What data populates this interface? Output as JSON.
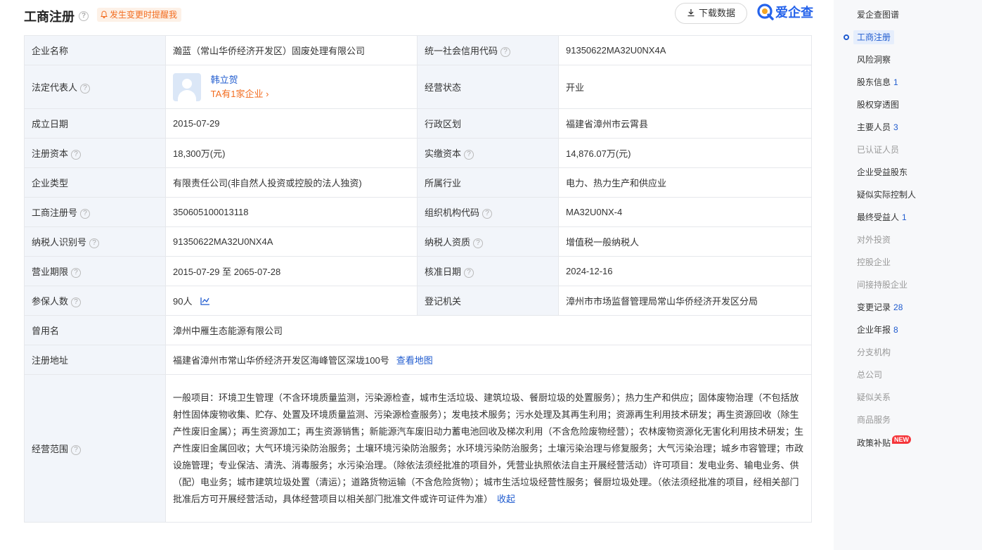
{
  "header": {
    "title": "工商注册",
    "notify_label": "发生变更时提醒我",
    "download_label": "下载数据",
    "brand_name": "爱企查"
  },
  "rows": [
    {
      "l1": "企业名称",
      "v1": "瀚蓝（常山华侨经济开发区）固废处理有限公司",
      "l2": "统一社会信用代码",
      "v2": "91350622MA32U0NX4A"
    },
    {
      "l1": "法定代表人",
      "v1_name": "韩立贺",
      "v1_link": "TA有1家企业",
      "l2": "经营状态",
      "v2": "开业"
    },
    {
      "l1": "成立日期",
      "v1": "2015-07-29",
      "l2": "行政区划",
      "v2": "福建省漳州市云霄县"
    },
    {
      "l1": "注册资本",
      "v1": "18,300万(元)",
      "l2": "实缴资本",
      "v2": "14,876.07万(元)"
    },
    {
      "l1": "企业类型",
      "v1": "有限责任公司(非自然人投资或控股的法人独资)",
      "l2": "所属行业",
      "v2": "电力、热力生产和供应业"
    },
    {
      "l1": "工商注册号",
      "v1": "350605100013118",
      "l2": "组织机构代码",
      "v2": "MA32U0NX-4"
    },
    {
      "l1": "纳税人识别号",
      "v1": "91350622MA32U0NX4A",
      "l2": "纳税人资质",
      "v2": "增值税一般纳税人"
    },
    {
      "l1": "营业期限",
      "v1": "2015-07-29 至 2065-07-28",
      "l2": "核准日期",
      "v2": "2024-12-16"
    },
    {
      "l1": "参保人数",
      "v1": "90人",
      "l2": "登记机关",
      "v2": "漳州市市场监督管理局常山华侨经济开发区分局"
    },
    {
      "l1": "曾用名",
      "v1": "漳州中雁生态能源有限公司"
    },
    {
      "l1": "注册地址",
      "v1": "福建省漳州市常山华侨经济开发区海峰管区深垅100号",
      "link": "查看地图"
    },
    {
      "l1": "经营范围",
      "v1": "一般项目：环境卫生管理（不含环境质量监测，污染源检查，城市生活垃圾、建筑垃圾、餐厨垃圾的处置服务）；热力生产和供应；固体废物治理（不包括放射性固体废物收集、贮存、处置及环境质量监测、污染源检查服务）；发电技术服务；污水处理及其再生利用；资源再生利用技术研发；再生资源回收（除生产性废旧金属）；再生资源加工；再生资源销售；新能源汽车废旧动力蓄电池回收及梯次利用（不含危险废物经营）；农林废物资源化无害化利用技术研发；生产性废旧金属回收；大气环境污染防治服务；土壤环境污染防治服务；水环境污染防治服务；土壤污染治理与修复服务；大气污染治理；城乡市容管理；市政设施管理；专业保洁、清洗、消毒服务；水污染治理。（除依法须经批准的项目外，凭营业执照依法自主开展经营活动）许可项目：发电业务、输电业务、供（配）电业务；城市建筑垃圾处置（清运）；道路货物运输（不含危险货物）；城市生活垃圾经营性服务；餐厨垃圾处理。（依法须经批准的项目，经相关部门批准后方可开展经营活动，具体经营项目以相关部门批准文件或许可证件为准）",
      "link": "收起"
    }
  ],
  "sidebar": {
    "items": [
      {
        "label": "爱企查图谱",
        "count": "",
        "state": "normal"
      },
      {
        "label": "工商注册",
        "count": "",
        "state": "active"
      },
      {
        "label": "风险洞察",
        "count": "",
        "state": "normal"
      },
      {
        "label": "股东信息",
        "count": "1",
        "state": "normal"
      },
      {
        "label": "股权穿透图",
        "count": "",
        "state": "normal"
      },
      {
        "label": "主要人员",
        "count": "3",
        "state": "normal"
      },
      {
        "label": "已认证人员",
        "count": "",
        "state": "dim"
      },
      {
        "label": "企业受益股东",
        "count": "",
        "state": "normal"
      },
      {
        "label": "疑似实际控制人",
        "count": "",
        "state": "normal"
      },
      {
        "label": "最终受益人",
        "count": "1",
        "state": "normal"
      },
      {
        "label": "对外投资",
        "count": "",
        "state": "dim"
      },
      {
        "label": "控股企业",
        "count": "",
        "state": "dim"
      },
      {
        "label": "间接持股企业",
        "count": "",
        "state": "dim"
      },
      {
        "label": "变更记录",
        "count": "28",
        "state": "normal"
      },
      {
        "label": "企业年报",
        "count": "8",
        "state": "normal"
      },
      {
        "label": "分支机构",
        "count": "",
        "state": "dim"
      },
      {
        "label": "总公司",
        "count": "",
        "state": "dim"
      },
      {
        "label": "疑似关系",
        "count": "",
        "state": "dim"
      },
      {
        "label": "商品服务",
        "count": "",
        "state": "dim"
      },
      {
        "label": "政策补贴",
        "count": "",
        "state": "normal",
        "badge": "NEW"
      }
    ]
  },
  "colors": {
    "accent_blue": "#1f5bcf",
    "accent_orange": "#f26d21",
    "label_bg": "#f2f5fa",
    "border": "#e6e8ec",
    "sidebar_bg": "#f7f8fa"
  }
}
